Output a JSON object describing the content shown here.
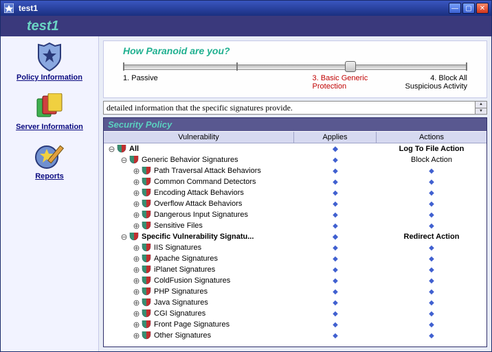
{
  "window": {
    "title": "test1"
  },
  "appHeader": "test1",
  "sidebar": {
    "items": [
      {
        "label": "Policy Information",
        "icon": "badge-star-icon"
      },
      {
        "label": "Server Information",
        "icon": "multi-docs-icon"
      },
      {
        "label": "Reports",
        "icon": "report-pencil-icon"
      }
    ]
  },
  "paranoid": {
    "heading": "How Paranoid are you?",
    "labels": {
      "l1": "1. Passive",
      "l3": "3. Basic Generic Protection",
      "l4": "4. Block All Suspicious Activity"
    },
    "thumb_percent": 66
  },
  "detail": {
    "value": "detailed information that the specific signatures provide."
  },
  "securityPolicy": {
    "title": "Security Policy",
    "columns": {
      "vulnerability": "Vulnerability",
      "applies": "Applies",
      "actions": "Actions"
    },
    "rows": [
      {
        "depth": 0,
        "expander": "open",
        "icon": true,
        "bold": true,
        "label": "All",
        "applies": "◆",
        "action": "Log To File Action"
      },
      {
        "depth": 1,
        "expander": "open",
        "icon": true,
        "bold": false,
        "label": "Generic Behavior Signatures",
        "applies": "◆",
        "action": "Block Action"
      },
      {
        "depth": 2,
        "expander": "closed",
        "icon": true,
        "bold": false,
        "label": "Path Traversal Attack Behaviors",
        "applies": "◆",
        "action": "◆"
      },
      {
        "depth": 2,
        "expander": "closed",
        "icon": true,
        "bold": false,
        "label": "Common Command Detectors",
        "applies": "◆",
        "action": "◆"
      },
      {
        "depth": 2,
        "expander": "closed",
        "icon": true,
        "bold": false,
        "label": "Encoding Attack Behaviors",
        "applies": "◆",
        "action": "◆"
      },
      {
        "depth": 2,
        "expander": "closed",
        "icon": true,
        "bold": false,
        "label": "Overflow Attack Behaviors",
        "applies": "◆",
        "action": "◆"
      },
      {
        "depth": 2,
        "expander": "closed",
        "icon": true,
        "bold": false,
        "label": "Dangerous Input Signatures",
        "applies": "◆",
        "action": "◆"
      },
      {
        "depth": 2,
        "expander": "closed",
        "icon": true,
        "bold": false,
        "label": "Sensitive Files",
        "applies": "◆",
        "action": "◆"
      },
      {
        "depth": 1,
        "expander": "open",
        "icon": true,
        "bold": true,
        "label": "Specific Vulnerability Signatu...",
        "applies": "◆",
        "action": "Redirect Action"
      },
      {
        "depth": 2,
        "expander": "closed",
        "icon": true,
        "bold": false,
        "label": "IIS Signatures",
        "applies": "◆",
        "action": "◆"
      },
      {
        "depth": 2,
        "expander": "closed",
        "icon": true,
        "bold": false,
        "label": "Apache Signatures",
        "applies": "◆",
        "action": "◆"
      },
      {
        "depth": 2,
        "expander": "closed",
        "icon": true,
        "bold": false,
        "label": "iPlanet Signatures",
        "applies": "◆",
        "action": "◆"
      },
      {
        "depth": 2,
        "expander": "closed",
        "icon": true,
        "bold": false,
        "label": "ColdFusion Signatures",
        "applies": "◆",
        "action": "◆"
      },
      {
        "depth": 2,
        "expander": "closed",
        "icon": true,
        "bold": false,
        "label": "PHP Signatures",
        "applies": "◆",
        "action": "◆"
      },
      {
        "depth": 2,
        "expander": "closed",
        "icon": true,
        "bold": false,
        "label": "Java Signatures",
        "applies": "◆",
        "action": "◆"
      },
      {
        "depth": 2,
        "expander": "closed",
        "icon": true,
        "bold": false,
        "label": "CGI Signatures",
        "applies": "◆",
        "action": "◆"
      },
      {
        "depth": 2,
        "expander": "closed",
        "icon": true,
        "bold": false,
        "label": "Front Page Signatures",
        "applies": "◆",
        "action": "◆"
      },
      {
        "depth": 2,
        "expander": "closed",
        "icon": true,
        "bold": false,
        "label": "Other Signatures",
        "applies": "◆",
        "action": "◆"
      }
    ]
  }
}
